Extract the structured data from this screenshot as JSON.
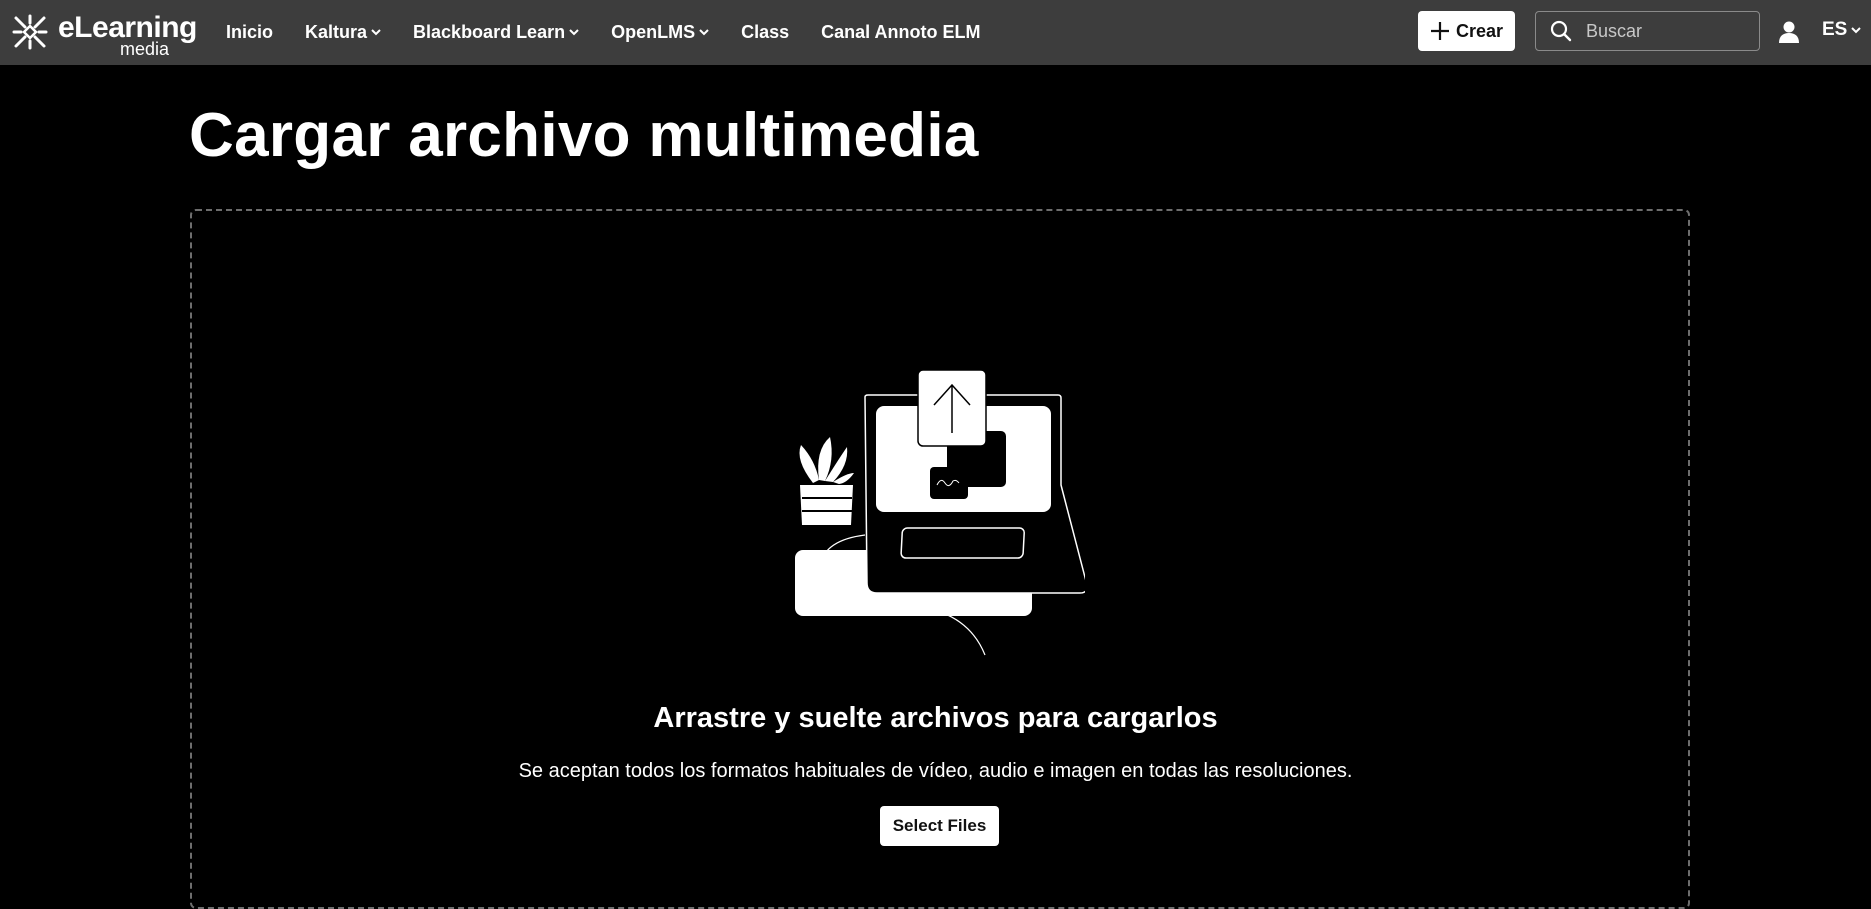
{
  "header": {
    "logo": {
      "main": "eLearning",
      "sub": "media"
    },
    "nav": [
      {
        "label": "Inicio",
        "dropdown": false
      },
      {
        "label": "Kaltura",
        "dropdown": true
      },
      {
        "label": "Blackboard Learn",
        "dropdown": true
      },
      {
        "label": "OpenLMS",
        "dropdown": true
      },
      {
        "label": "Class",
        "dropdown": false
      },
      {
        "label": "Canal Annoto ELM",
        "dropdown": false
      }
    ],
    "create_label": "Crear",
    "search_placeholder": "Buscar",
    "language": "ES"
  },
  "main": {
    "title": "Cargar archivo multimedia",
    "dropzone": {
      "heading": "Arrastre y suelte archivos para cargarlos",
      "description": "Se aceptan todos los formatos habituales de vídeo, audio e imagen en todas las resoluciones.",
      "select_label": "Select Files"
    }
  },
  "colors": {
    "header_bg": "#3d3d3d",
    "page_bg": "#000000",
    "text": "#ffffff",
    "button_bg": "#ffffff",
    "dashed_border": "#6e6e6e"
  },
  "icons": [
    "logo-icon",
    "chevron-down-icon",
    "plus-icon",
    "search-icon",
    "user-icon",
    "upload-illustration"
  ]
}
